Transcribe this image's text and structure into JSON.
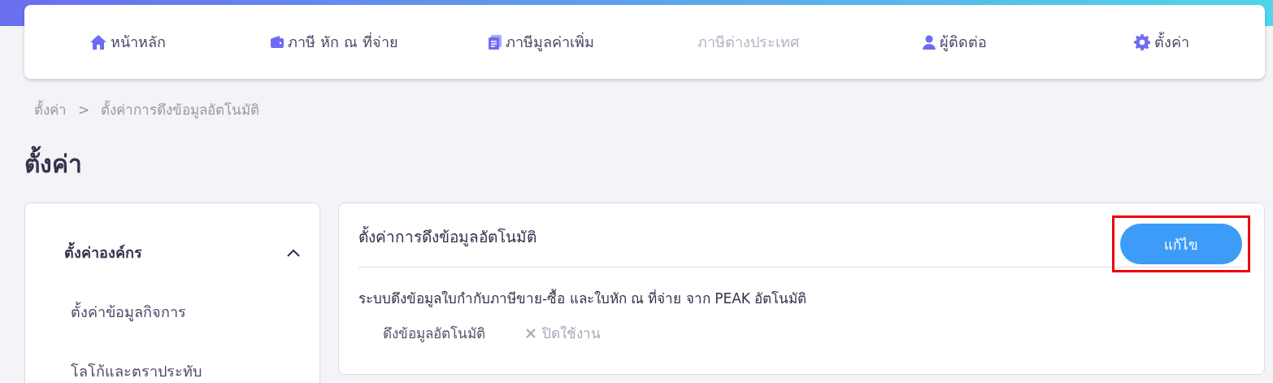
{
  "nav": [
    {
      "label": "หน้าหลัก",
      "disabled": false
    },
    {
      "label": "ภาษี หัก ณ ที่จ่าย",
      "disabled": false
    },
    {
      "label": "ภาษีมูลค่าเพิ่ม",
      "disabled": false
    },
    {
      "label": "ภาษีต่างประเทศ",
      "disabled": true
    },
    {
      "label": "ผู้ติดต่อ",
      "disabled": false
    },
    {
      "label": "ตั้งค่า",
      "disabled": false
    }
  ],
  "breadcrumb": [
    "ตั้งค่า",
    "ตั้งค่าการดึงข้อมูลอัตโนมัติ"
  ],
  "breadcrumb_separator": ">",
  "page_title": "ตั้งค่า",
  "sidebar": {
    "groups": [
      {
        "label": "ตั้งค่าองค์กร",
        "expanded": true,
        "children": [
          {
            "label": "ตั้งค่าข้อมูลกิจการ"
          },
          {
            "label": "โลโก้และตราประทับ"
          }
        ]
      }
    ]
  },
  "panel": {
    "title": "ตั้งค่าการดึงข้อมูลอัตโนมัติ",
    "edit_button": {
      "label": "แก้ไข",
      "highlighted": true
    },
    "description": "ระบบดึงข้อมูลใบกำกับภาษีขาย-ซื้อ และใบหัก ณ ที่จ่าย จาก PEAK อัตโนมัติ",
    "setting": {
      "label": "ดึงข้อมูลอัตโนมัติ",
      "on": false,
      "value": "ปิดใช้งาน"
    }
  }
}
